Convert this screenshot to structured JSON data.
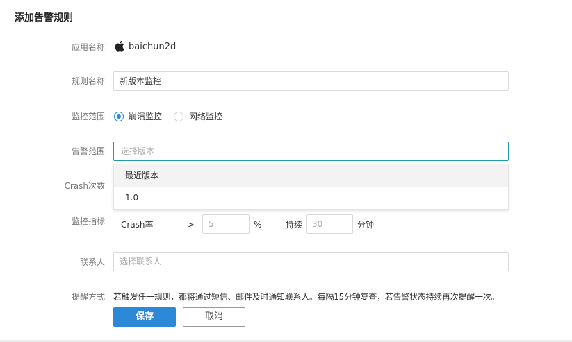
{
  "page_title": "添加告警规则",
  "app": {
    "label": "应用名称",
    "icon": "apple-icon",
    "name": "baichun2d"
  },
  "rule_name": {
    "label": "规则名称",
    "value": "新版本监控"
  },
  "monitor_scope": {
    "label": "监控范围",
    "options": [
      {
        "label": "崩溃监控",
        "checked": true
      },
      {
        "label": "网络监控",
        "checked": false
      }
    ]
  },
  "alert_scope": {
    "label": "告警范围",
    "placeholder": "选择版本",
    "dropdown": [
      "最近版本",
      "1.0"
    ]
  },
  "crash_count": {
    "label": "Crash次数"
  },
  "metric": {
    "label": "监控指标",
    "name": "Crash率",
    "operator": ">",
    "threshold_placeholder": "5",
    "unit": "%",
    "duration_label": "持续",
    "duration_placeholder": "30",
    "duration_unit": "分钟"
  },
  "contact": {
    "label": "联系人",
    "placeholder": "选择联系人"
  },
  "notify": {
    "label": "提醒方式",
    "text": "若触发任一规则，都将通过短信、邮件及时通知联系人。每隔15分钟复查，若告警状态持续再次提醒一次。"
  },
  "buttons": {
    "save": "保存",
    "cancel": "取消"
  },
  "colors": {
    "primary": "#2d88d8",
    "focus_border": "#1f9aa8"
  }
}
